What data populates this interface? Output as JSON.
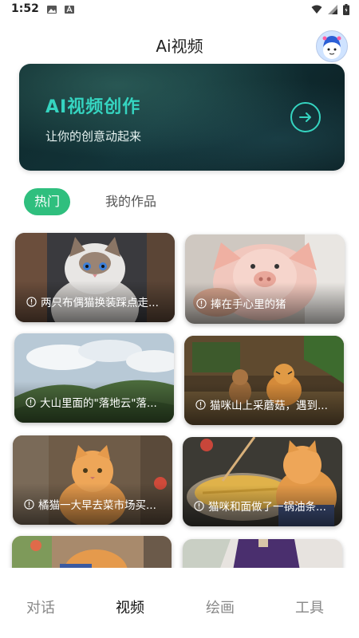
{
  "status_bar": {
    "time": "1:52"
  },
  "header": {
    "title": "Ai视频"
  },
  "hero": {
    "title": "AI视频创作",
    "subtitle": "让你的创意动起来"
  },
  "tabs": [
    {
      "label": "热门",
      "active": true
    },
    {
      "label": "我的作品",
      "active": false
    }
  ],
  "videos": [
    {
      "caption": "两只布偶猫换装踩点走...",
      "theme": "ragdoll-cat"
    },
    {
      "caption": "捧在手心里的猪",
      "theme": "piglet"
    },
    {
      "caption": "大山里面的\"落地云\"落...",
      "theme": "mountain-clouds"
    },
    {
      "caption": "猫咪山上采蘑菇，遇到...",
      "theme": "monkey-tiger"
    },
    {
      "caption": "橘猫一大早去菜市场买...",
      "theme": "orange-cat-market"
    },
    {
      "caption": "猫咪和面做了一锅油条...",
      "theme": "orange-cat-cooking"
    }
  ],
  "bottom_nav": [
    {
      "label": "对话",
      "active": false
    },
    {
      "label": "视频",
      "active": true
    },
    {
      "label": "绘画",
      "active": false
    },
    {
      "label": "工具",
      "active": false
    }
  ],
  "colors": {
    "accent": "#2fbf7e",
    "hero_text": "#35d4c0",
    "nav_active": "#111111",
    "nav_inactive": "#888888"
  }
}
